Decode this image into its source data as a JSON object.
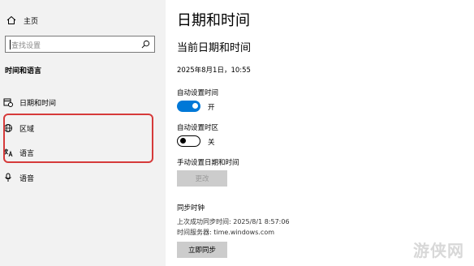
{
  "sidebar": {
    "home_label": "主页",
    "search_placeholder": "查找设置",
    "section_label": "时间和语言",
    "items": [
      {
        "label": "日期和时间",
        "icon": "calendar-clock-icon"
      },
      {
        "label": "区域",
        "icon": "globe-icon"
      },
      {
        "label": "语言",
        "icon": "language-icon"
      },
      {
        "label": "语音",
        "icon": "microphone-icon"
      }
    ]
  },
  "main": {
    "title": "日期和时间",
    "subtitle": "当前日期和时间",
    "current_datetime": "2025年8月1日，10:55",
    "auto_time": {
      "label": "自动设置时间",
      "state": "开",
      "on": true
    },
    "auto_timezone": {
      "label": "自动设置时区",
      "state": "关",
      "on": false
    },
    "manual": {
      "label": "手动设置日期和时间",
      "button": "更改"
    },
    "sync": {
      "label": "同步时钟",
      "last_sync": "上次成功同步时间: 2025/8/1 8:57:06",
      "server": "时间服务器: time.windows.com",
      "button": "立即同步"
    }
  },
  "watermark": "游侠网",
  "colors": {
    "accent": "#0078d7",
    "highlight": "#d63a3a"
  }
}
